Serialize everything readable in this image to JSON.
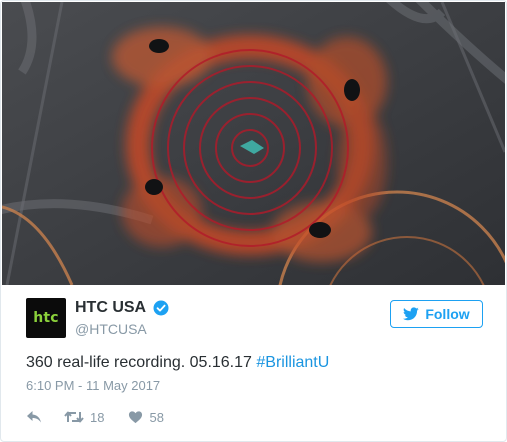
{
  "media": {
    "kind": "video-still",
    "colors": {
      "ground": "#3a3c40",
      "smoke": "#d2552e",
      "rings": "#b21a2a"
    }
  },
  "author": {
    "avatar_text": "htc",
    "display_name": "HTC USA",
    "handle": "@HTCUSA",
    "verified_icon": "verified-badge-icon"
  },
  "follow": {
    "label": "Follow",
    "icon": "twitter-bird-icon"
  },
  "tweet": {
    "text": "360 real-life recording. 05.16.17",
    "hashtag": "#BrilliantU"
  },
  "timestamp": "6:10 PM - 11 May 2017",
  "actions": {
    "reply_icon": "reply-icon",
    "retweet_icon": "retweet-icon",
    "retweet_count": "18",
    "like_icon": "heart-icon",
    "like_count": "58"
  },
  "colors": {
    "accent": "#1da1f2",
    "text": "#292f33",
    "muted": "#8899a6"
  }
}
